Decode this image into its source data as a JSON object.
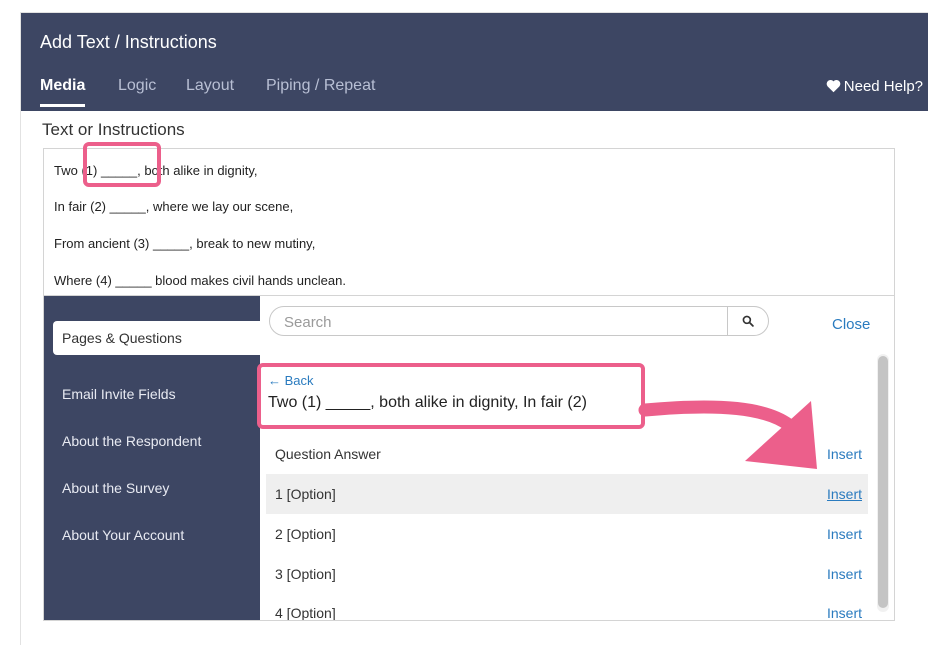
{
  "modal": {
    "title": "Add Text / Instructions",
    "tabs": [
      {
        "label": "Media",
        "active": true
      },
      {
        "label": "Logic",
        "active": false
      },
      {
        "label": "Layout",
        "active": false
      },
      {
        "label": "Piping / Repeat",
        "active": false
      }
    ],
    "help_label": "Need Help?"
  },
  "editor": {
    "section_label": "Text or Instructions",
    "lines": [
      "Two (1) _____, both alike in dignity,",
      "In fair (2) _____, where we lay our scene,",
      "From ancient (3) _____, break to new mutiny,",
      "Where (4) _____ blood makes civil hands unclean."
    ]
  },
  "piping": {
    "categories": [
      {
        "label": "Pages & Questions",
        "active": true
      },
      {
        "label": "Email Invite Fields",
        "active": false
      },
      {
        "label": "About the Respondent",
        "active": false
      },
      {
        "label": "About the Survey",
        "active": false
      },
      {
        "label": "About Your Account",
        "active": false
      }
    ],
    "search": {
      "placeholder": "Search",
      "value": ""
    },
    "close_label": "Close",
    "back_label": "← Back",
    "breadcrumb": "Two (1) _____, both alike in dignity, In fair (2)",
    "rows": [
      {
        "label": "Question Answer",
        "action": "Insert",
        "highlighted": false
      },
      {
        "label": "1 [Option]",
        "action": "Insert",
        "highlighted": true
      },
      {
        "label": "2 [Option]",
        "action": "Insert",
        "highlighted": false
      },
      {
        "label": "3 [Option]",
        "action": "Insert",
        "highlighted": false
      },
      {
        "label": "4 [Option]",
        "action": "Insert",
        "highlighted": false
      }
    ]
  },
  "icons": {
    "help": "heart-icon",
    "search": "search-icon"
  },
  "colors": {
    "header_bg": "#3d4663",
    "link": "#2a7bbf",
    "annotation": "#ec5f8b",
    "row_highlight": "#efefef"
  }
}
